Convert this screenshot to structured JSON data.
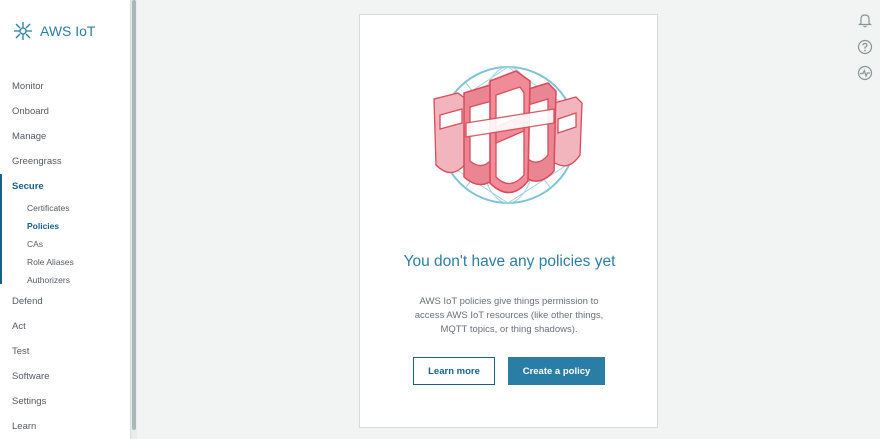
{
  "brand": {
    "name": "AWS IoT",
    "icon": "aws-iot-logo"
  },
  "nav": {
    "monitor": "Monitor",
    "onboard": "Onboard",
    "manage": "Manage",
    "greengrass": "Greengrass",
    "secure": "Secure",
    "secure_items": [
      "Certificates",
      "Policies",
      "CAs",
      "Role Aliases",
      "Authorizers"
    ],
    "defend": "Defend",
    "act": "Act",
    "test": "Test",
    "software": "Software",
    "settings": "Settings",
    "learn": "Learn"
  },
  "empty_state": {
    "title": "You don't have any policies yet",
    "description": "AWS IoT policies give things permission to access AWS IoT resources (like other things, MQTT topics, or thing shadows).",
    "learn_more_label": "Learn more",
    "create_label": "Create a policy",
    "illustration": "policy-shields-illustration"
  },
  "utility_icons": [
    "bell-icon",
    "help-icon",
    "activity-icon"
  ],
  "colors": {
    "accent": "#2a7ea5",
    "active_nav": "#16608a",
    "shield_red": "#e36f7c"
  }
}
